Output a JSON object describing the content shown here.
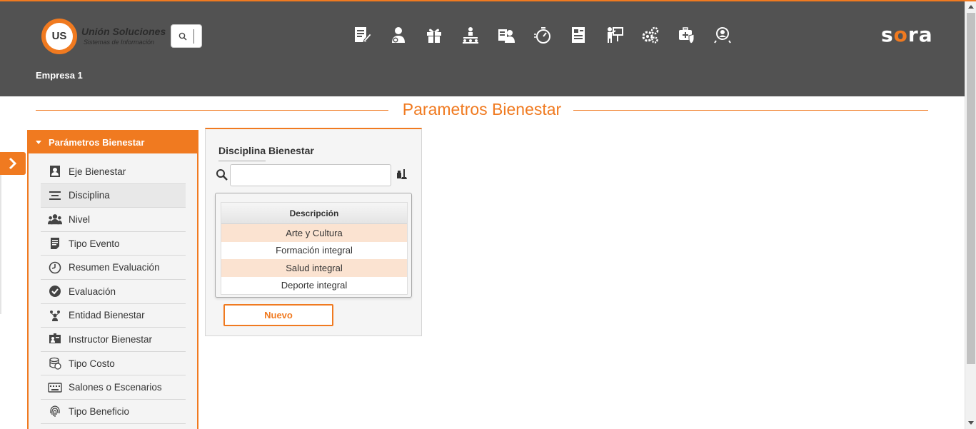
{
  "brand": {
    "logo_mark": "US",
    "company_title": "Unión Soluciones",
    "company_subtitle": "Sistemas de Información",
    "product_name_a": "s",
    "product_name_b": "o",
    "product_name_c": "ra",
    "accent_color": "#f07a20",
    "header_color": "#525252"
  },
  "header": {
    "company": "Empresa 1",
    "search_icon": "search-icon",
    "nav_icons": [
      "document-edit-icon",
      "user-admin-icon",
      "gift-icon",
      "org-structure-icon",
      "employee-card-icon",
      "timer-icon",
      "report-sheet-icon",
      "training-board-icon",
      "settings-gears-icon",
      "health-case-icon",
      "user-search-icon"
    ]
  },
  "page": {
    "title": "Parametros Bienestar"
  },
  "sidebar": {
    "header": "Parámetros Bienestar",
    "items": [
      {
        "label": "Eje Bienestar",
        "icon": "id-badge-icon"
      },
      {
        "label": "Disciplina",
        "icon": "align-lines-icon"
      },
      {
        "label": "Nivel",
        "icon": "people-group-icon"
      },
      {
        "label": "Tipo Evento",
        "icon": "document-list-icon"
      },
      {
        "label": "Resumen Evaluación",
        "icon": "clock-icon"
      },
      {
        "label": "Evaluación",
        "icon": "check-circle-icon"
      },
      {
        "label": "Entidad Bienestar",
        "icon": "network-people-icon"
      },
      {
        "label": "Instructor Bienestar",
        "icon": "instructor-board-icon"
      },
      {
        "label": "Tipo Costo",
        "icon": "coins-icon"
      },
      {
        "label": "Salones o Escenarios",
        "icon": "keyboard-icon"
      },
      {
        "label": "Tipo Beneficio",
        "icon": "fingerprint-icon"
      }
    ]
  },
  "panel": {
    "title": "Disciplina Bienestar",
    "search_value": "",
    "search_placeholder": "",
    "table_header": "Descripción",
    "rows": [
      "Arte y Cultura",
      "Formación integral",
      "Salud integral",
      "Deporte integral"
    ],
    "new_button": "Nuevo"
  }
}
